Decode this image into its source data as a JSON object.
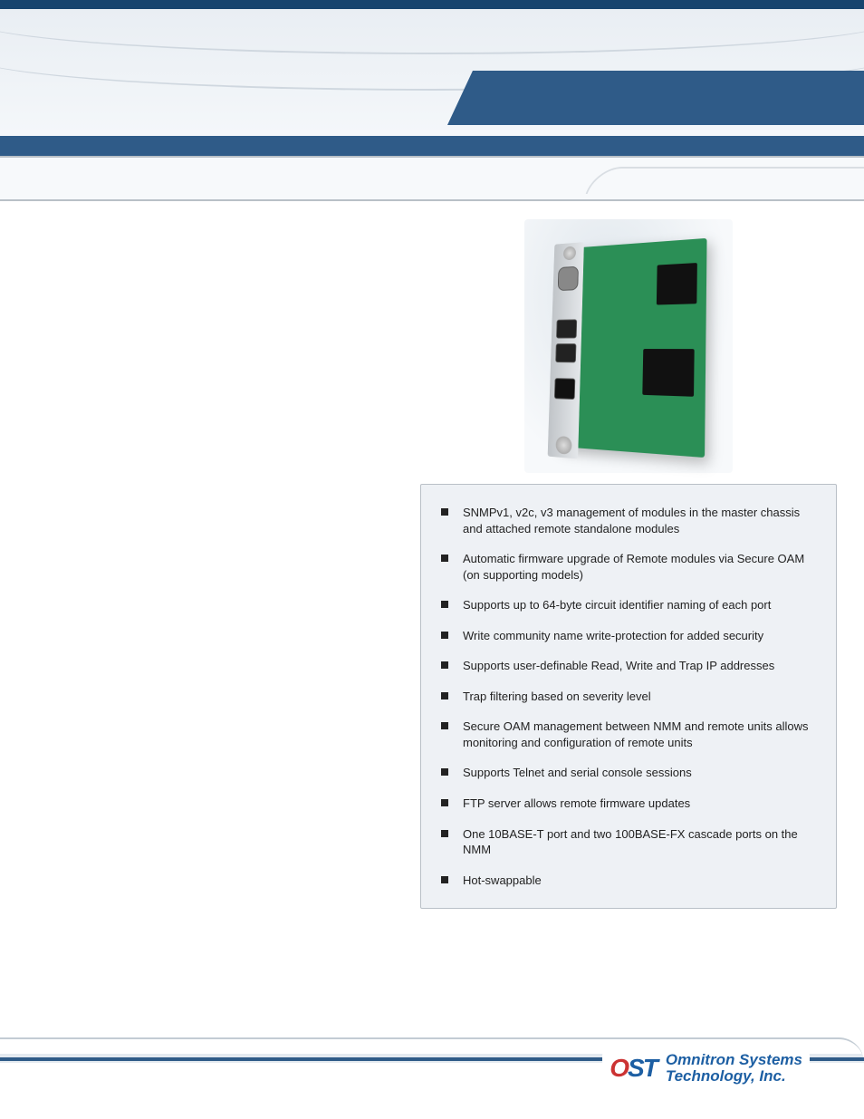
{
  "features": {
    "items": [
      "SNMPv1, v2c, v3 management of modules in the master chassis and attached remote standalone modules",
      "Automatic firmware upgrade of Remote modules via Secure OAM (on supporting models)",
      "Supports up to 64-byte circuit identifier naming of each port",
      "Write community name write-protection for added security",
      "Supports user-definable Read, Write and Trap IP addresses",
      "Trap filtering based on severity level",
      "Secure OAM management between NMM and remote units allows monitoring and configuration of remote units",
      "Supports Telnet and serial console sessions",
      "FTP server allows remote firmware updates",
      "One 10BASE-T port and two 100BASE-FX cascade ports on the NMM",
      "Hot-swappable"
    ]
  },
  "logo": {
    "mark": "OST",
    "line1": "Omnitron Systems",
    "line2": "Technology, Inc."
  }
}
